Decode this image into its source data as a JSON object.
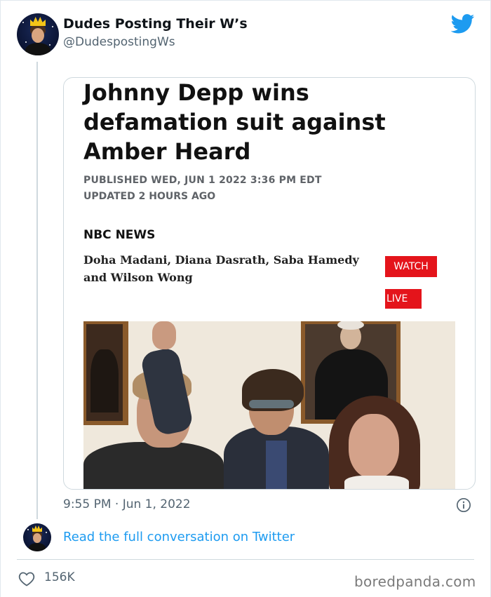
{
  "tweet": {
    "author_name": "Dudes Posting Their W’s",
    "author_handle": "@DudespostingWs",
    "timestamp": "9:55 PM · Jun 1, 2022",
    "read_more_link": "Read the full conversation on Twitter",
    "likes": "156K"
  },
  "article": {
    "headline_lines": [
      "Johnny Depp wins",
      "defamation suit against",
      "Amber Heard"
    ],
    "published": "PUBLISHED WED, JUN 1 2022 3:36 PM EDT",
    "updated": "UPDATED 2 HOURS AGO",
    "source": "NBC NEWS",
    "authors_lines": [
      "Doha Madani, Diana Dasrath, Saba Hamedy",
      "and Wilson Wong"
    ],
    "watch_label": "WATCH",
    "live_label": "LIVE"
  },
  "watermark": "boredpanda.com",
  "icons": {
    "brand": "twitter-bird-icon",
    "info": "info-icon",
    "like": "heart-icon"
  },
  "colors": {
    "twitter_blue": "#1d9bf0",
    "nbc_red": "#e4141b",
    "secondary_text": "#536471"
  }
}
